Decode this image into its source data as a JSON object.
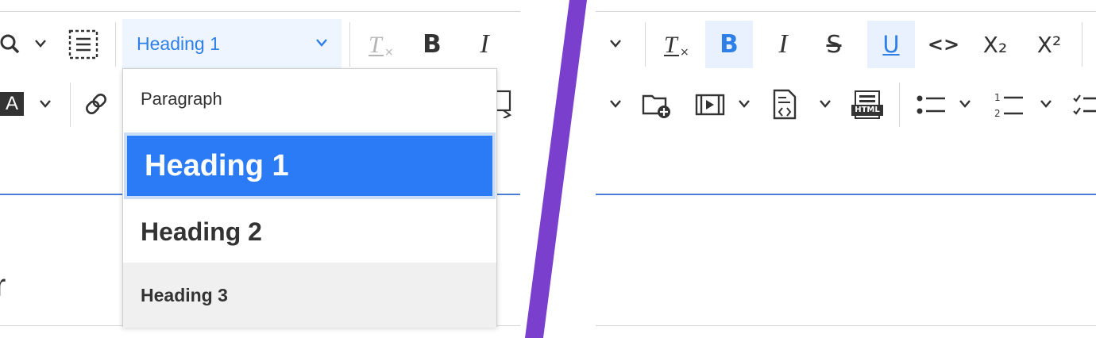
{
  "left_panel": {
    "toolbar_row1": {
      "heading_select": {
        "label": "Heading 1"
      },
      "italic_label": "I",
      "bold_label": "B"
    },
    "toolbar_row2": {
      "font_color_glyph": "A"
    },
    "heading_dropdown": {
      "options": [
        {
          "label": "Paragraph",
          "selected": false
        },
        {
          "label": "Heading 1",
          "selected": true
        },
        {
          "label": "Heading 2",
          "selected": false
        },
        {
          "label": "Heading 3",
          "selected": false
        }
      ]
    },
    "editor_partial_text": "r"
  },
  "right_panel": {
    "toolbar_row1": {
      "bold_label": "B",
      "italic_label": "I",
      "strikethrough_label": "S",
      "underline_label": "U",
      "code_label": "<>",
      "subscript_label": "X₂",
      "superscript_label": "X²"
    },
    "toolbar_row2": {
      "html_label": "HTML"
    }
  },
  "colors": {
    "accent": "#2e7fe8",
    "selected_option_bg": "#2b7bf6",
    "active_button_bg": "#e8f1fd",
    "divider": "#7b3fce",
    "editor_border": "#4a7fd9"
  }
}
